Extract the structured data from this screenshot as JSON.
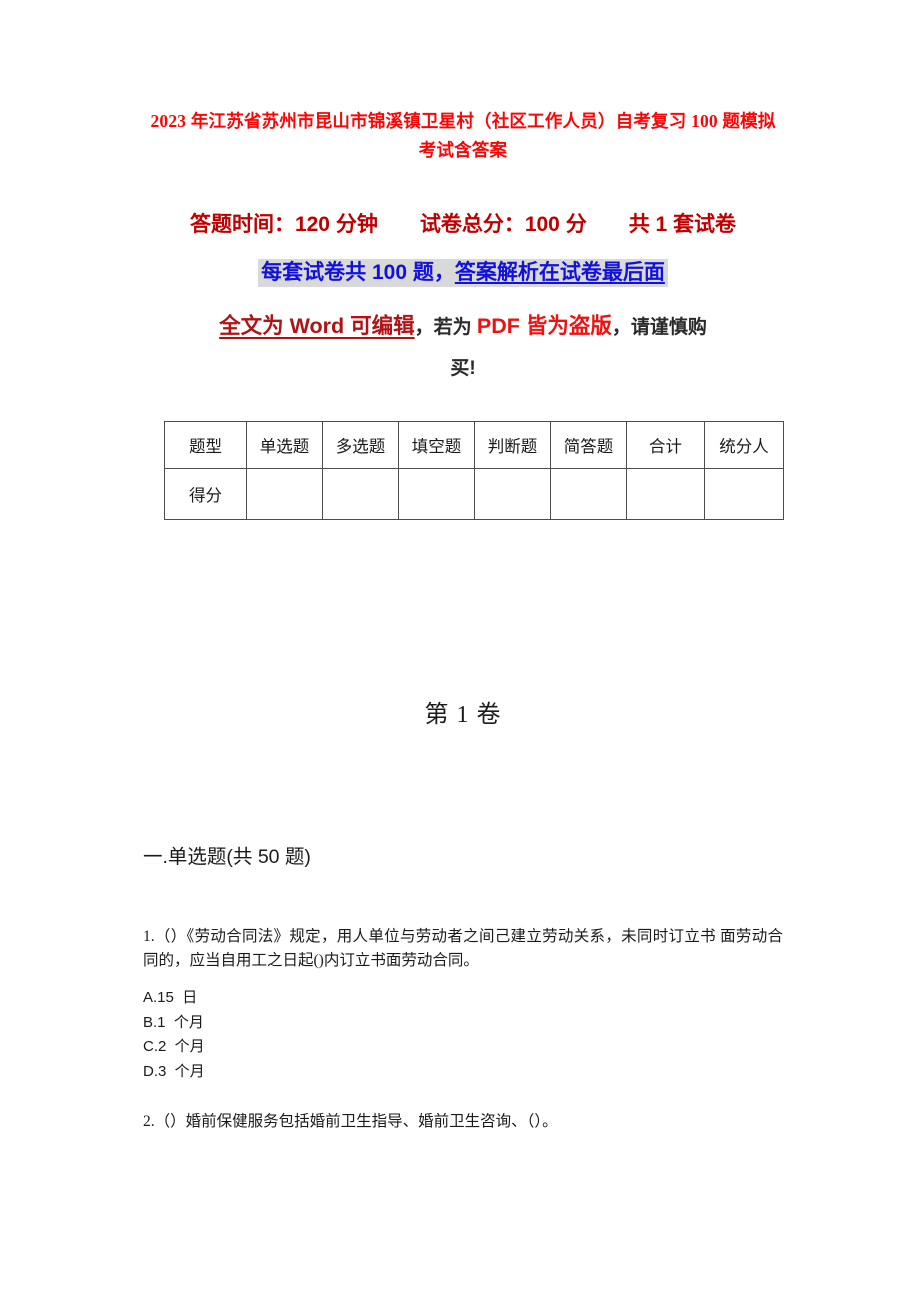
{
  "document": {
    "title": "2023 年江苏省苏州市昆山市锦溪镇卫星村（社区工作人员）自考复习 100 题模拟考试含答案",
    "title_color": "#fb0606"
  },
  "subtitle": {
    "line1": "答题时间：120 分钟　　试卷总分：100 分　　共 1 套试卷",
    "line1_color": "#c00000",
    "line2_text": "每套试卷共 100 题，",
    "line2_underlined": "答案解析在试卷最后面",
    "line2_color": "#1111dd",
    "line2_highlight": "#d9d9d9",
    "line3_a": "全文为 Word 可编辑",
    "line3_a_color": "#b11216",
    "line3_b": "，若为 ",
    "line3_c": "PDF 皆为盗版",
    "line3_c_color": "#ee1111",
    "line3_d": "，请谨慎购",
    "line4": "买!"
  },
  "score_table": {
    "headers": [
      "题型",
      "单选题",
      "多选题",
      "填空题",
      "判断题",
      "简答题",
      "合计",
      "统分人"
    ],
    "rows": [
      {
        "label": "得分",
        "values": [
          "",
          "",
          "",
          "",
          "",
          "",
          ""
        ]
      }
    ]
  },
  "volume": {
    "heading": "第 1 卷"
  },
  "section": {
    "heading": "一.单选题(共 50 题)"
  },
  "questions": [
    {
      "stem": "1.（）《劳动合同法》规定，用人单位与劳动者之间己建立劳动关系，未同时订立书 面劳动合同的，应当自用工之日起()内订立书面劳动合同。",
      "options": [
        "A.15  日",
        "B.1  个月",
        "C.2  个月",
        "D.3  个月"
      ]
    },
    {
      "stem": "2.（）婚前保健服务包括婚前卫生指导、婚前卫生咨询、（）。",
      "options": []
    }
  ]
}
